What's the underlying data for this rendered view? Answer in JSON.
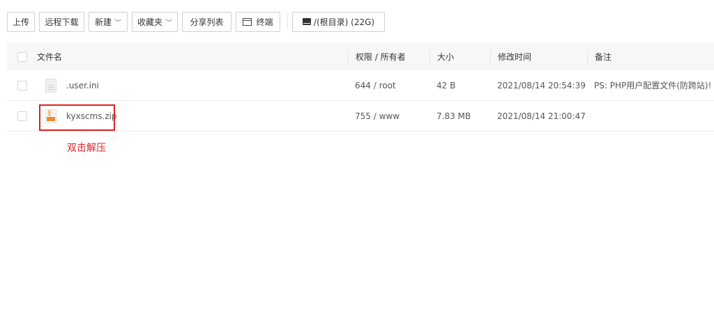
{
  "toolbar": {
    "upload": "上传",
    "remote_download": "远程下载",
    "new": "新建",
    "favorites": "收藏夹",
    "share_list": "分享列表",
    "terminal": "终端",
    "path": "/(根目录) (22G)"
  },
  "table": {
    "headers": {
      "name": "文件名",
      "permission": "权限 / 所有者",
      "size": "大小",
      "modified": "修改时间",
      "note": "备注"
    },
    "rows": [
      {
        "name": ".user.ini",
        "permission": "644 / root",
        "size": "42 B",
        "modified": "2021/08/14 20:54:39",
        "note": "PS: PHP用户配置文件(防跨站)!",
        "icon": "ini-file-icon"
      },
      {
        "name": "kyxscms.zip",
        "permission": "755 / www",
        "size": "7.83 MB",
        "modified": "2021/08/14 21:00:47",
        "note": "",
        "icon": "zip-file-icon"
      }
    ]
  },
  "annotation": {
    "text": "双击解压",
    "color": "#e02020"
  }
}
